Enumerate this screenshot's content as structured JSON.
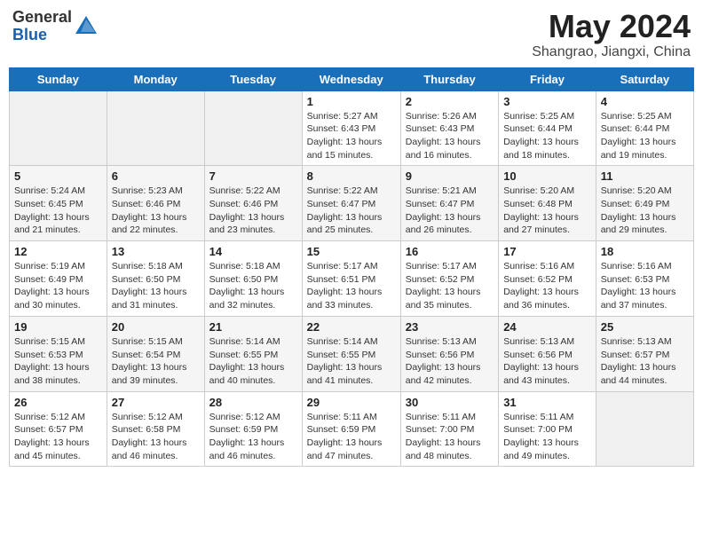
{
  "header": {
    "logo_general": "General",
    "logo_blue": "Blue",
    "month_year": "May 2024",
    "location": "Shangrao, Jiangxi, China"
  },
  "weekdays": [
    "Sunday",
    "Monday",
    "Tuesday",
    "Wednesday",
    "Thursday",
    "Friday",
    "Saturday"
  ],
  "weeks": [
    [
      {
        "day": "",
        "sunrise": "",
        "sunset": "",
        "daylight": "",
        "empty": true
      },
      {
        "day": "",
        "sunrise": "",
        "sunset": "",
        "daylight": "",
        "empty": true
      },
      {
        "day": "",
        "sunrise": "",
        "sunset": "",
        "daylight": "",
        "empty": true
      },
      {
        "day": "1",
        "sunrise": "Sunrise: 5:27 AM",
        "sunset": "Sunset: 6:43 PM",
        "daylight": "Daylight: 13 hours and 15 minutes."
      },
      {
        "day": "2",
        "sunrise": "Sunrise: 5:26 AM",
        "sunset": "Sunset: 6:43 PM",
        "daylight": "Daylight: 13 hours and 16 minutes."
      },
      {
        "day": "3",
        "sunrise": "Sunrise: 5:25 AM",
        "sunset": "Sunset: 6:44 PM",
        "daylight": "Daylight: 13 hours and 18 minutes."
      },
      {
        "day": "4",
        "sunrise": "Sunrise: 5:25 AM",
        "sunset": "Sunset: 6:44 PM",
        "daylight": "Daylight: 13 hours and 19 minutes."
      }
    ],
    [
      {
        "day": "5",
        "sunrise": "Sunrise: 5:24 AM",
        "sunset": "Sunset: 6:45 PM",
        "daylight": "Daylight: 13 hours and 21 minutes."
      },
      {
        "day": "6",
        "sunrise": "Sunrise: 5:23 AM",
        "sunset": "Sunset: 6:46 PM",
        "daylight": "Daylight: 13 hours and 22 minutes."
      },
      {
        "day": "7",
        "sunrise": "Sunrise: 5:22 AM",
        "sunset": "Sunset: 6:46 PM",
        "daylight": "Daylight: 13 hours and 23 minutes."
      },
      {
        "day": "8",
        "sunrise": "Sunrise: 5:22 AM",
        "sunset": "Sunset: 6:47 PM",
        "daylight": "Daylight: 13 hours and 25 minutes."
      },
      {
        "day": "9",
        "sunrise": "Sunrise: 5:21 AM",
        "sunset": "Sunset: 6:47 PM",
        "daylight": "Daylight: 13 hours and 26 minutes."
      },
      {
        "day": "10",
        "sunrise": "Sunrise: 5:20 AM",
        "sunset": "Sunset: 6:48 PM",
        "daylight": "Daylight: 13 hours and 27 minutes."
      },
      {
        "day": "11",
        "sunrise": "Sunrise: 5:20 AM",
        "sunset": "Sunset: 6:49 PM",
        "daylight": "Daylight: 13 hours and 29 minutes."
      }
    ],
    [
      {
        "day": "12",
        "sunrise": "Sunrise: 5:19 AM",
        "sunset": "Sunset: 6:49 PM",
        "daylight": "Daylight: 13 hours and 30 minutes."
      },
      {
        "day": "13",
        "sunrise": "Sunrise: 5:18 AM",
        "sunset": "Sunset: 6:50 PM",
        "daylight": "Daylight: 13 hours and 31 minutes."
      },
      {
        "day": "14",
        "sunrise": "Sunrise: 5:18 AM",
        "sunset": "Sunset: 6:50 PM",
        "daylight": "Daylight: 13 hours and 32 minutes."
      },
      {
        "day": "15",
        "sunrise": "Sunrise: 5:17 AM",
        "sunset": "Sunset: 6:51 PM",
        "daylight": "Daylight: 13 hours and 33 minutes."
      },
      {
        "day": "16",
        "sunrise": "Sunrise: 5:17 AM",
        "sunset": "Sunset: 6:52 PM",
        "daylight": "Daylight: 13 hours and 35 minutes."
      },
      {
        "day": "17",
        "sunrise": "Sunrise: 5:16 AM",
        "sunset": "Sunset: 6:52 PM",
        "daylight": "Daylight: 13 hours and 36 minutes."
      },
      {
        "day": "18",
        "sunrise": "Sunrise: 5:16 AM",
        "sunset": "Sunset: 6:53 PM",
        "daylight": "Daylight: 13 hours and 37 minutes."
      }
    ],
    [
      {
        "day": "19",
        "sunrise": "Sunrise: 5:15 AM",
        "sunset": "Sunset: 6:53 PM",
        "daylight": "Daylight: 13 hours and 38 minutes."
      },
      {
        "day": "20",
        "sunrise": "Sunrise: 5:15 AM",
        "sunset": "Sunset: 6:54 PM",
        "daylight": "Daylight: 13 hours and 39 minutes."
      },
      {
        "day": "21",
        "sunrise": "Sunrise: 5:14 AM",
        "sunset": "Sunset: 6:55 PM",
        "daylight": "Daylight: 13 hours and 40 minutes."
      },
      {
        "day": "22",
        "sunrise": "Sunrise: 5:14 AM",
        "sunset": "Sunset: 6:55 PM",
        "daylight": "Daylight: 13 hours and 41 minutes."
      },
      {
        "day": "23",
        "sunrise": "Sunrise: 5:13 AM",
        "sunset": "Sunset: 6:56 PM",
        "daylight": "Daylight: 13 hours and 42 minutes."
      },
      {
        "day": "24",
        "sunrise": "Sunrise: 5:13 AM",
        "sunset": "Sunset: 6:56 PM",
        "daylight": "Daylight: 13 hours and 43 minutes."
      },
      {
        "day": "25",
        "sunrise": "Sunrise: 5:13 AM",
        "sunset": "Sunset: 6:57 PM",
        "daylight": "Daylight: 13 hours and 44 minutes."
      }
    ],
    [
      {
        "day": "26",
        "sunrise": "Sunrise: 5:12 AM",
        "sunset": "Sunset: 6:57 PM",
        "daylight": "Daylight: 13 hours and 45 minutes."
      },
      {
        "day": "27",
        "sunrise": "Sunrise: 5:12 AM",
        "sunset": "Sunset: 6:58 PM",
        "daylight": "Daylight: 13 hours and 46 minutes."
      },
      {
        "day": "28",
        "sunrise": "Sunrise: 5:12 AM",
        "sunset": "Sunset: 6:59 PM",
        "daylight": "Daylight: 13 hours and 46 minutes."
      },
      {
        "day": "29",
        "sunrise": "Sunrise: 5:11 AM",
        "sunset": "Sunset: 6:59 PM",
        "daylight": "Daylight: 13 hours and 47 minutes."
      },
      {
        "day": "30",
        "sunrise": "Sunrise: 5:11 AM",
        "sunset": "Sunset: 7:00 PM",
        "daylight": "Daylight: 13 hours and 48 minutes."
      },
      {
        "day": "31",
        "sunrise": "Sunrise: 5:11 AM",
        "sunset": "Sunset: 7:00 PM",
        "daylight": "Daylight: 13 hours and 49 minutes."
      },
      {
        "day": "",
        "sunrise": "",
        "sunset": "",
        "daylight": "",
        "empty": true
      }
    ]
  ]
}
